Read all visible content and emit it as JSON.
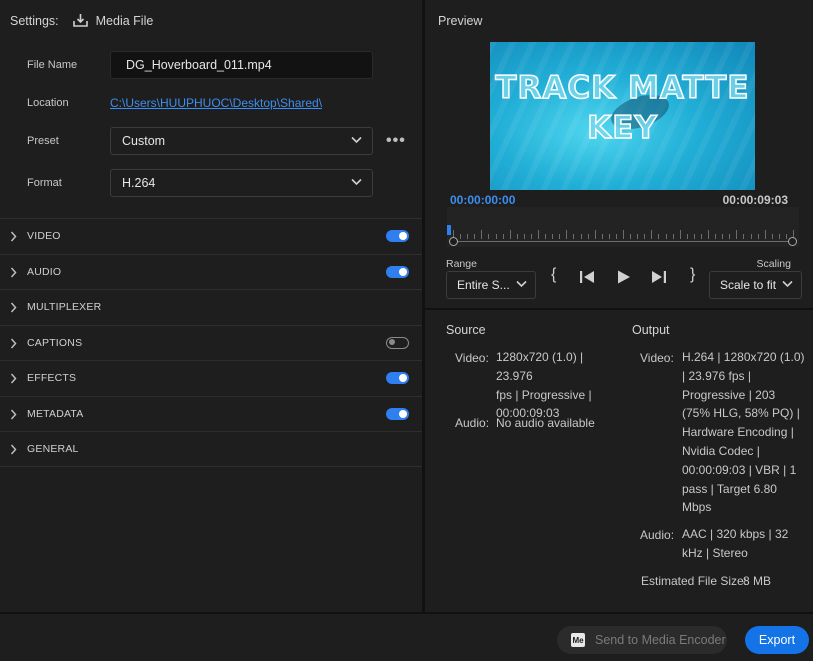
{
  "header": {
    "settings_label": "Settings:",
    "media_file_label": "Media File",
    "media_file_icon": "download-icon"
  },
  "fields": {
    "file_name_label": "File Name",
    "file_name_value": "DG_Hoverboard_011.mp4",
    "location_label": "Location",
    "location_value": "C:\\Users\\HUUPHUOC\\Desktop\\Shared\\",
    "preset_label": "Preset",
    "preset_value": "Custom",
    "format_label": "Format",
    "format_value": "H.264",
    "more_label": "•••"
  },
  "sections": [
    {
      "name": "VIDEO",
      "toggle": "on"
    },
    {
      "name": "AUDIO",
      "toggle": "on"
    },
    {
      "name": "MULTIPLEXER",
      "toggle": "none"
    },
    {
      "name": "CAPTIONS",
      "toggle": "off"
    },
    {
      "name": "EFFECTS",
      "toggle": "on"
    },
    {
      "name": "METADATA",
      "toggle": "on"
    },
    {
      "name": "GENERAL",
      "toggle": "none"
    }
  ],
  "preview": {
    "title": "Preview",
    "thumb_line1": "TRACK MATTE",
    "thumb_line2": "KEY",
    "timecode_start": "00:00:00:00",
    "timecode_end": "00:00:09:03",
    "range_label": "Range",
    "range_value": "Entire S...",
    "scaling_label": "Scaling",
    "scaling_value": "Scale to fit",
    "in_point": "{",
    "out_point": "}"
  },
  "source": {
    "title": "Source",
    "video_label": "Video:",
    "video_lines": [
      "1280x720 (1.0) | 23.976",
      "fps | Progressive |",
      "00:00:09:03"
    ],
    "audio_label": "Audio:",
    "audio_value": "No audio available"
  },
  "output": {
    "title": "Output",
    "video_label": "Video:",
    "video_lines": [
      "H.264 | 1280x720 (1.0)",
      "| 23.976 fps |",
      "Progressive | 203",
      "(75% HLG, 58% PQ) |",
      "Hardware Encoding |",
      "Nvidia Codec |",
      "00:00:09:03 | VBR | 1",
      "pass | Target 6.80",
      "Mbps"
    ],
    "audio_label": "Audio:",
    "audio_lines": [
      "AAC | 320 kbps | 32",
      "kHz | Stereo"
    ],
    "size_label": "Estimated File Size:",
    "size_value": "8 MB"
  },
  "footer": {
    "send_icon_text": "Me",
    "send_label": "Send to Media Encoder",
    "export_label": "Export"
  },
  "colors": {
    "accent": "#1473e6",
    "link": "#3d8ef0",
    "background": "#1e1e1e"
  }
}
